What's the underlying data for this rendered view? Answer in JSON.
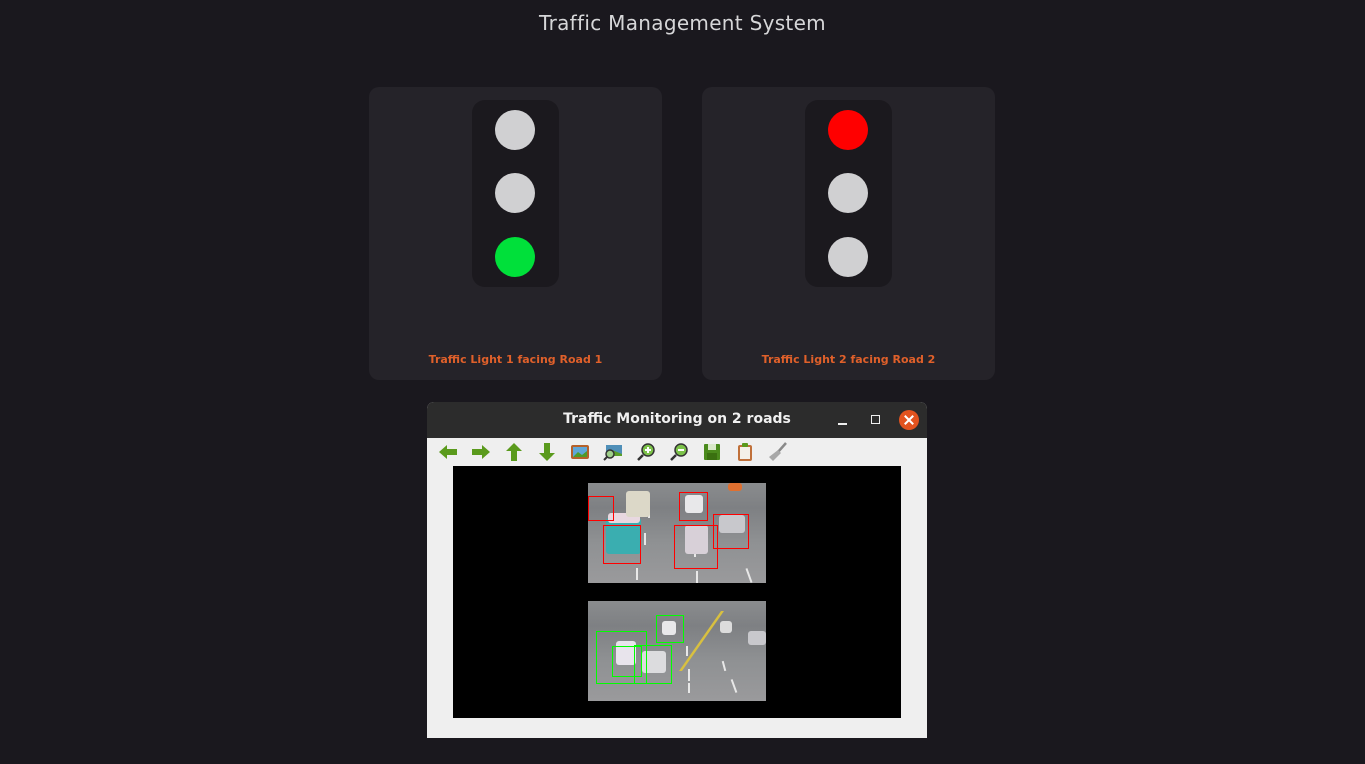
{
  "page": {
    "title": "Traffic Management System"
  },
  "lights": [
    {
      "label": "Traffic Light 1 facing Road 1",
      "active": "green",
      "lamps": [
        {
          "position": "top",
          "color": "#d0d0d2",
          "state": "off"
        },
        {
          "position": "middle",
          "color": "#d0d0d2",
          "state": "off"
        },
        {
          "position": "bottom",
          "color": "#00e03a",
          "state": "on"
        }
      ]
    },
    {
      "label": "Traffic Light 2 facing Road 2",
      "active": "red",
      "lamps": [
        {
          "position": "top",
          "color": "#ff0000",
          "state": "on"
        },
        {
          "position": "middle",
          "color": "#d0d0d2",
          "state": "off"
        },
        {
          "position": "bottom",
          "color": "#d0d0d2",
          "state": "off"
        }
      ]
    }
  ],
  "window": {
    "title": "Traffic Monitoring on 2 roads",
    "controls": [
      "minimize",
      "maximize",
      "close"
    ],
    "toolbar": [
      {
        "name": "pan-left-icon",
        "color": "#5a9a1c"
      },
      {
        "name": "pan-right-icon",
        "color": "#5a9a1c"
      },
      {
        "name": "pan-up-icon",
        "color": "#5a9a1c"
      },
      {
        "name": "pan-down-icon",
        "color": "#5a9a1c"
      },
      {
        "name": "image-icon",
        "color": "#b5612a"
      },
      {
        "name": "zoom-fit-icon",
        "color": "#4a8a3a"
      },
      {
        "name": "zoom-in-icon",
        "color": "#5a9a1c"
      },
      {
        "name": "zoom-out-icon",
        "color": "#5a9a1c"
      },
      {
        "name": "save-icon",
        "color": "#4a8a1c"
      },
      {
        "name": "clipboard-icon",
        "color": "#c0703a"
      },
      {
        "name": "clear-icon",
        "color": "#909090"
      }
    ],
    "feeds": [
      {
        "road": 1,
        "box_color": "#ff0000",
        "detections": 6
      },
      {
        "road": 2,
        "box_color": "#00ff00",
        "detections": 4
      }
    ]
  },
  "colors": {
    "background": "#1a181e",
    "card": "#252329",
    "label_accent": "#e0602a",
    "green_on": "#00e03a",
    "red_on": "#ff0000",
    "lamp_off": "#d0d0d2"
  }
}
